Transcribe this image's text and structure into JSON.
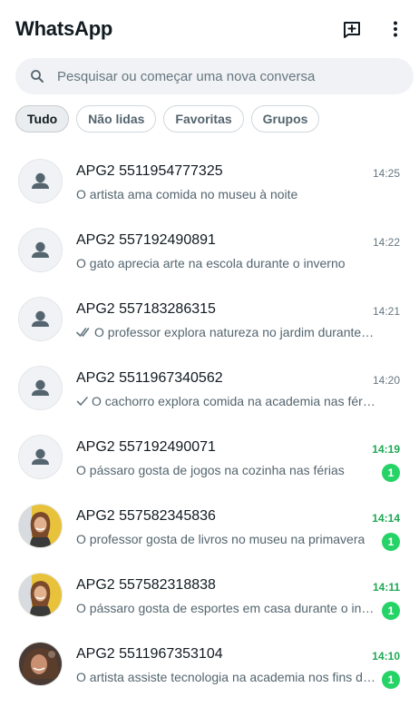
{
  "header": {
    "title": "WhatsApp",
    "new_chat_icon": "new-chat-icon",
    "menu_icon": "more-vertical-icon"
  },
  "search": {
    "placeholder": "Pesquisar ou começar uma nova conversa",
    "value": ""
  },
  "filters": [
    {
      "label": "Tudo",
      "active": true
    },
    {
      "label": "Não lidas",
      "active": false
    },
    {
      "label": "Favoritas",
      "active": false
    },
    {
      "label": "Grupos",
      "active": false
    }
  ],
  "colors": {
    "accent_green": "#1fa855",
    "badge_green": "#25d366",
    "muted_text": "#667781"
  },
  "chats": [
    {
      "name": "APG2 5511954777325",
      "time": "14:25",
      "message": "O artista ama comida no museu à noite",
      "status": "none",
      "unread": "",
      "avatar": "default"
    },
    {
      "name": "APG2 557192490891",
      "time": "14:22",
      "message": "O gato aprecia arte na escola durante o inverno",
      "status": "none",
      "unread": "",
      "avatar": "default"
    },
    {
      "name": "APG2 557183286315",
      "time": "14:21",
      "message": "O professor explora natureza no jardim durante o i...",
      "status": "double-check",
      "unread": "",
      "avatar": "default"
    },
    {
      "name": "APG2 5511967340562",
      "time": "14:20",
      "message": "O cachorro explora comida na academia nas férias",
      "status": "single-check",
      "unread": "",
      "avatar": "default"
    },
    {
      "name": "APG2 557192490071",
      "time": "14:19",
      "message": "O pássaro gosta de jogos na cozinha nas férias",
      "status": "none",
      "unread": "1",
      "avatar": "default"
    },
    {
      "name": "APG2 557582345836",
      "time": "14:14",
      "message": "O professor gosta de livros no museu na primavera",
      "status": "none",
      "unread": "1",
      "avatar": "photo-yellow"
    },
    {
      "name": "APG2 557582318838",
      "time": "14:11",
      "message": "O pássaro gosta de esportes em casa durante o inv...",
      "status": "none",
      "unread": "1",
      "avatar": "photo-yellow"
    },
    {
      "name": "APG2 5511967353104",
      "time": "14:10",
      "message": "O artista assiste tecnologia na academia nos fins de...",
      "status": "none",
      "unread": "1",
      "avatar": "photo-brown"
    }
  ]
}
